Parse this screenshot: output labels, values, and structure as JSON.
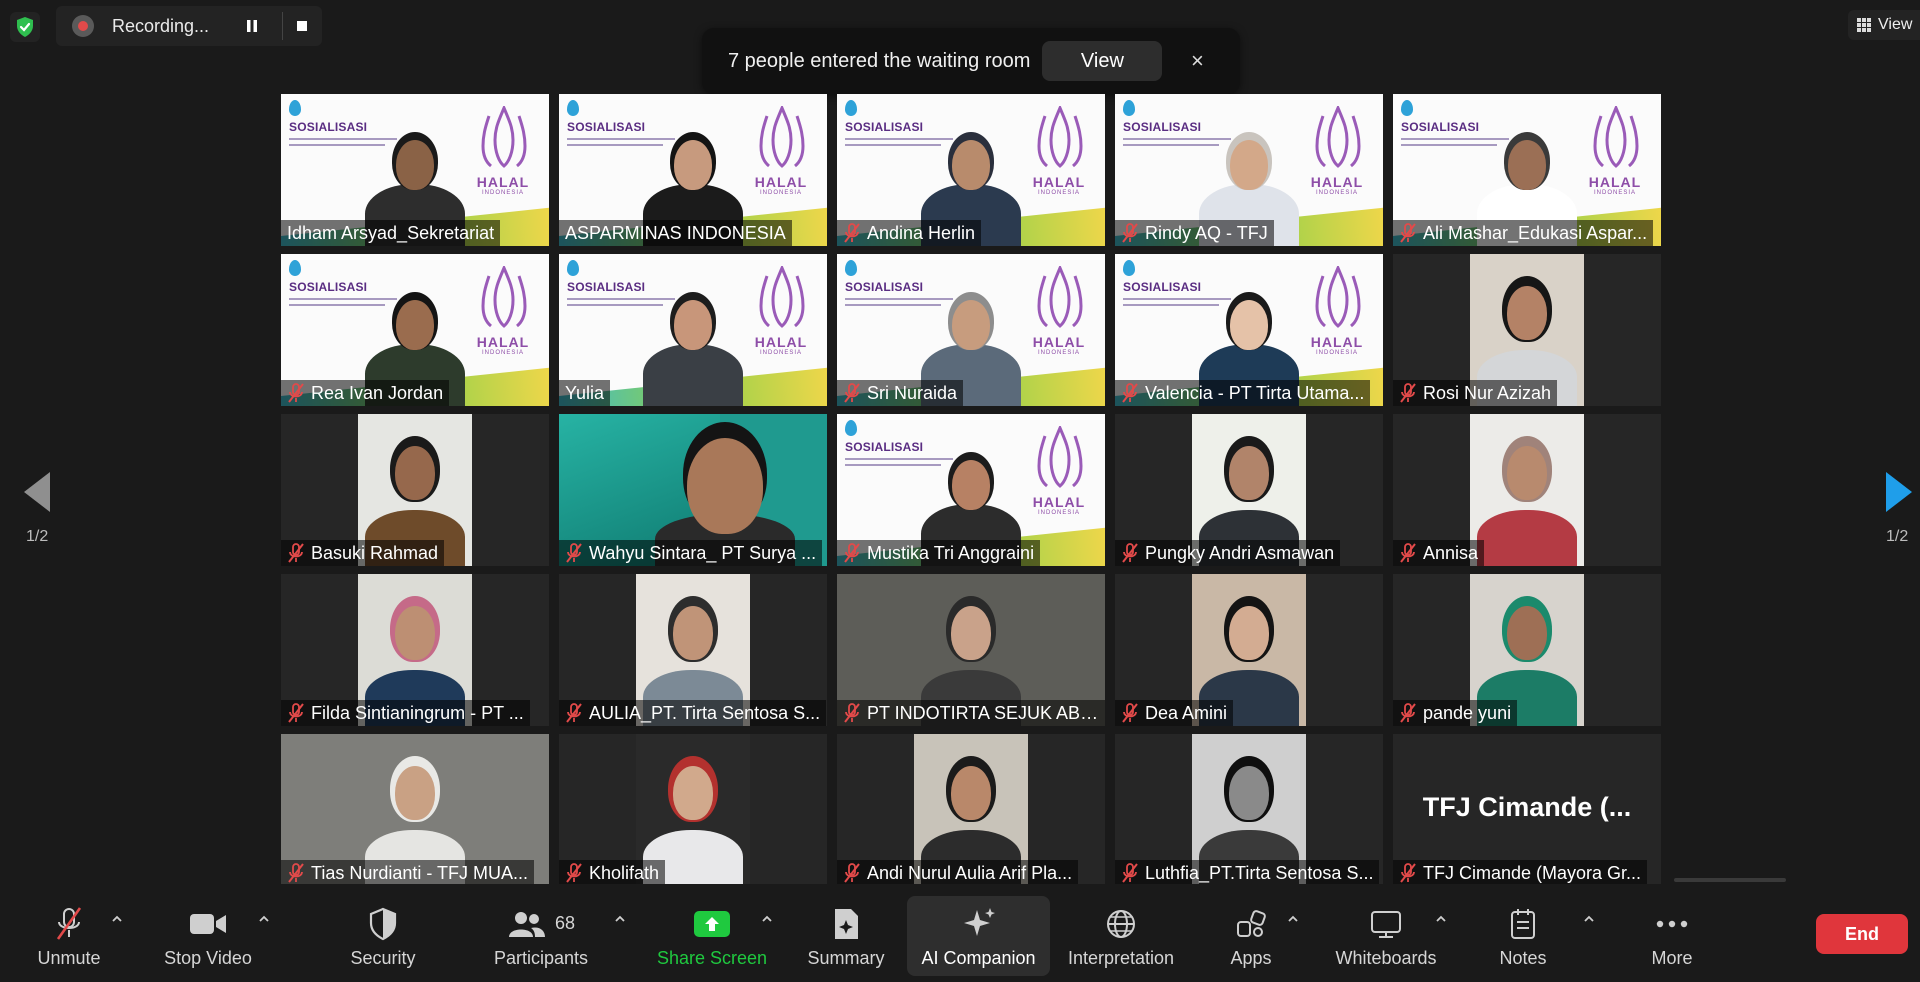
{
  "recording": {
    "label": "Recording..."
  },
  "top_right": {
    "view_label": "View"
  },
  "notification": {
    "text": "7 people entered the waiting room",
    "view_label": "View",
    "close_glyph": "×"
  },
  "page_indicator": {
    "left": "1/2",
    "right": "1/2"
  },
  "banner_text": {
    "title": "SOSIALISASI",
    "halal": "HALAL",
    "indonesia": "INDONESIA"
  },
  "participants": [
    {
      "name": "Idham Arsyad_Sekretariat",
      "muted": false,
      "active": false,
      "video": "banner",
      "skin": "#8a6246",
      "cloth": "#2d2d2d",
      "hair": "#1a1a1a"
    },
    {
      "name": "ASPARMINAS INDONESIA",
      "muted": false,
      "active": true,
      "video": "banner",
      "skin": "#c79a7e",
      "cloth": "#1b1b1b",
      "hair": "#141414"
    },
    {
      "name": "Andina Herlin",
      "muted": true,
      "active": false,
      "video": "banner",
      "skin": "#b88b6c",
      "cloth": "#2b3a4f",
      "hair": "#2a2f3c"
    },
    {
      "name": "Rindy AQ - TFJ",
      "muted": true,
      "active": false,
      "video": "banner",
      "skin": "#d3a889",
      "cloth": "#dfe3ea",
      "hair": "#c9c4be"
    },
    {
      "name": "Ali Mashar_Edukasi Aspar...",
      "muted": true,
      "active": false,
      "video": "banner",
      "skin": "#9b6f55",
      "cloth": "#ffffff",
      "hair": "#3a3a3a"
    },
    {
      "name": "Rea Ivan Jordan",
      "muted": true,
      "active": false,
      "video": "banner",
      "skin": "#9a6c4e",
      "cloth": "#2d3b2c",
      "hair": "#141414"
    },
    {
      "name": "Yulia",
      "muted": false,
      "active": false,
      "video": "banner",
      "skin": "#c8967a",
      "cloth": "#3a3f45",
      "hair": "#1d1d1d"
    },
    {
      "name": "Sri Nuraida",
      "muted": true,
      "active": false,
      "video": "banner",
      "skin": "#c79c7e",
      "cloth": "#5b6a7a",
      "hair": "#8d8d8d"
    },
    {
      "name": "Valencia - PT Tirta Utama...",
      "muted": true,
      "active": false,
      "video": "banner",
      "skin": "#e5c2a8",
      "cloth": "#1e3b57",
      "hair": "#1a1a1a"
    },
    {
      "name": "Rosi Nur Azizah",
      "muted": true,
      "active": false,
      "video": "center",
      "bg": "#d9d2c8",
      "skin": "#b48266",
      "cloth": "#d4d6d8",
      "hair": "#161616"
    },
    {
      "name": "Basuki Rahmad",
      "muted": true,
      "active": false,
      "video": "center",
      "bg": "#e5e6e2",
      "skin": "#96684c",
      "cloth": "#6e4b2a",
      "hair": "#1a1a1a"
    },
    {
      "name": "Wahyu Sintara_ PT Surya ...",
      "muted": true,
      "active": false,
      "video": "teal",
      "bg": "#1f9a8f",
      "skin": "#a97859",
      "cloth": "#2a2a2a",
      "hair": "#141414"
    },
    {
      "name": "Mustika Tri Anggraini",
      "muted": true,
      "active": false,
      "video": "banner",
      "skin": "#b78164",
      "cloth": "#2c2c2c",
      "hair": "#1c1c1c"
    },
    {
      "name": "Pungky Andri Asmawan",
      "muted": true,
      "active": false,
      "video": "center",
      "bg": "#eef0ea",
      "skin": "#b1846a",
      "cloth": "#2d3136",
      "hair": "#1a1a1a"
    },
    {
      "name": "Annisa",
      "muted": true,
      "active": false,
      "video": "center",
      "bg": "#ecebe8",
      "skin": "#b88a6e",
      "cloth": "#b43b44",
      "hair": "#a0837a"
    },
    {
      "name": "Filda Sintianingrum - PT ...",
      "muted": true,
      "active": false,
      "video": "center",
      "bg": "#dcdcd6",
      "skin": "#bd8f73",
      "cloth": "#1f3a5a",
      "hair": "#c56a88"
    },
    {
      "name": "AULIA_PT. Tirta Sentosa S...",
      "muted": true,
      "active": false,
      "video": "center",
      "bg": "#e6e2dc",
      "skin": "#c09478",
      "cloth": "#7c8a96",
      "hair": "#2d2d2d"
    },
    {
      "name": "PT INDOTIRTA SEJUK ABA...",
      "muted": true,
      "active": false,
      "video": "full",
      "bg": "#5d5d58",
      "skin": "#c9a28a",
      "cloth": "#3a3a3a",
      "hair": "#2a2a2a"
    },
    {
      "name": "Dea Amini",
      "muted": true,
      "active": false,
      "video": "center",
      "bg": "#c9b8a6",
      "skin": "#d3ac92",
      "cloth": "#2b3848",
      "hair": "#141414"
    },
    {
      "name": "pande yuni",
      "muted": true,
      "active": false,
      "video": "center",
      "bg": "#d7d3cd",
      "skin": "#9e6f55",
      "cloth": "#1c7c66",
      "hair": "#1b8a6c"
    },
    {
      "name": "Tias Nurdianti - TFJ MUA...",
      "muted": true,
      "active": false,
      "video": "full",
      "bg": "#7e7e7a",
      "skin": "#c9a184",
      "cloth": "#e5e5e2",
      "hair": "#e9e9e6"
    },
    {
      "name": "Kholifath",
      "muted": true,
      "active": false,
      "video": "center",
      "bg": "#2a2a2a",
      "skin": "#d1a98c",
      "cloth": "#e8e8ea",
      "hair": "#b3312e"
    },
    {
      "name": "Andi Nurul Aulia Arif Pla...",
      "muted": true,
      "active": false,
      "video": "center",
      "bg": "#c8c3b9",
      "skin": "#b9886a",
      "cloth": "#2c2c2c",
      "hair": "#1b1b1b"
    },
    {
      "name": "Luthfia_PT.Tirta Sentosa S...",
      "muted": true,
      "active": false,
      "video": "center",
      "bg": "#cfcfcf",
      "skin": "#8a8a8a",
      "cloth": "#3a3a3a",
      "hair": "#0f0f0f"
    },
    {
      "name": "TFJ Cimande (Mayora Gr...",
      "muted": true,
      "active": false,
      "video": "none",
      "big_name": "TFJ Cimande (..."
    }
  ],
  "toolbar": {
    "unmute": "Unmute",
    "stop_video": "Stop Video",
    "security": "Security",
    "participants": "Participants",
    "participants_count": "68",
    "share_screen": "Share Screen",
    "summary": "Summary",
    "ai_companion": "AI Companion",
    "interpretation": "Interpretation",
    "apps": "Apps",
    "whiteboards": "Whiteboards",
    "notes": "Notes",
    "more": "More",
    "end": "End"
  },
  "colors": {
    "accent_green": "#1fc93f",
    "end_red": "#e0363c",
    "active_border": "#e8e24a",
    "mute_red": "#e24a4a"
  }
}
